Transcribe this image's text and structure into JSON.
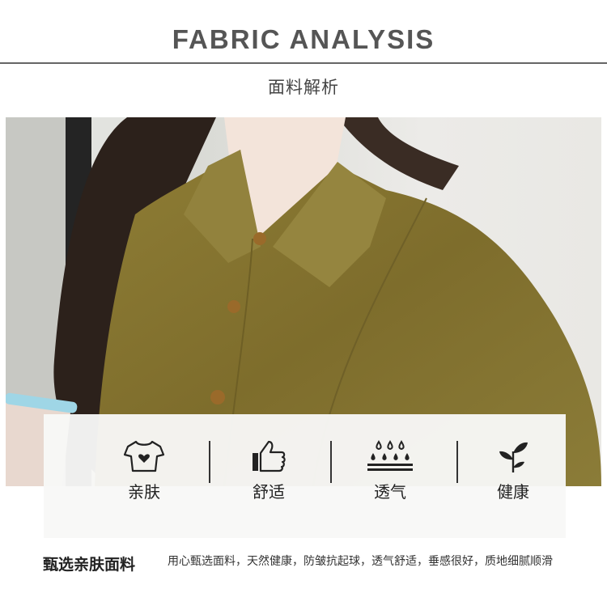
{
  "header": {
    "title": "FABRIC ANALYSIS",
    "subtitle": "面料解析"
  },
  "photo": {
    "shirt_color": "#8a7a34"
  },
  "features": [
    {
      "icon": "tshirt-heart-icon",
      "label": "亲肤"
    },
    {
      "icon": "thumbs-up-icon",
      "label": "舒适"
    },
    {
      "icon": "water-drops-icon",
      "label": "透气"
    },
    {
      "icon": "sprout-icon",
      "label": "健康"
    }
  ],
  "description": {
    "heading": "甄选亲肤面料",
    "text": "用心甄选面料，天然健康，防皱抗起球，透气舒适，垂感很好，质地细腻顺滑"
  }
}
